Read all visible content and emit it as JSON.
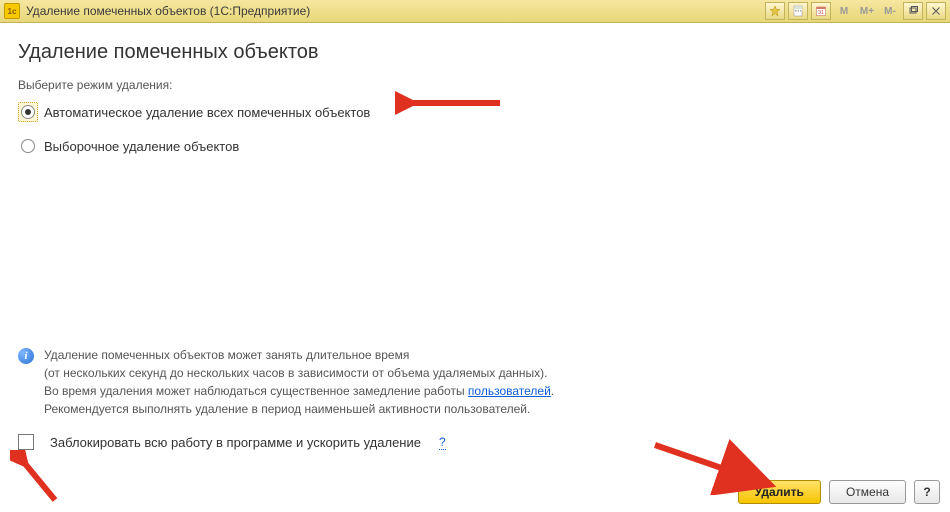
{
  "titlebar": {
    "title": "Удаление помеченных объектов  (1С:Предприятие)",
    "mbuttons": [
      "M",
      "M+",
      "M-"
    ]
  },
  "header": {
    "title": "Удаление помеченных объектов"
  },
  "mode": {
    "prompt": "Выберите режим удаления:",
    "auto": "Автоматическое удаление всех помеченных объектов",
    "selective": "Выборочное удаление объектов"
  },
  "info": {
    "line1": "Удаление помеченных объектов может занять длительное время",
    "line2": "(от нескольких секунд до нескольких часов в зависимости от объема удаляемых данных).",
    "line3_a": "Во время удаления может наблюдаться существенное замедление работы ",
    "line3_link": "пользователей",
    "line3_b": ".",
    "line4": "Рекомендуется выполнять удаление в период наименьшей активности пользователей."
  },
  "checkbox": {
    "label": "Заблокировать всю работу в программе и ускорить удаление",
    "help": "?"
  },
  "buttons": {
    "delete": "Удалить",
    "cancel": "Отмена",
    "help": "?"
  }
}
